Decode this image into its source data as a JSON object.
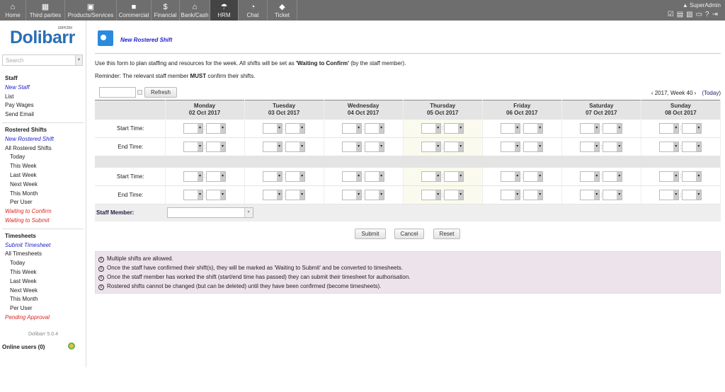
{
  "topmenu": [
    {
      "label": "Home",
      "icon": "home-icon",
      "glyph": "⌂",
      "w": 37
    },
    {
      "label": "Third parties",
      "icon": "building-icon",
      "glyph": "▦",
      "w": 55
    },
    {
      "label": "Products/Services",
      "icon": "image-icon",
      "glyph": "▣",
      "w": 73
    },
    {
      "label": "Commercial",
      "icon": "briefcase-icon",
      "glyph": "■",
      "w": 49
    },
    {
      "label": "Financial",
      "icon": "dollar-icon",
      "glyph": "$",
      "w": 40
    },
    {
      "label": "Bank/Cash",
      "icon": "bank-icon",
      "glyph": "⌂",
      "w": 43
    },
    {
      "label": "HRM",
      "icon": "umbrella-icon",
      "glyph": "☂",
      "w": 40,
      "active": true
    },
    {
      "label": "Chat",
      "icon": "chat-icon",
      "glyph": "◔",
      "w": 41
    },
    {
      "label": "Ticket",
      "icon": "ticket-icon",
      "glyph": "◆",
      "w": 42
    }
  ],
  "user": "SuperAdmin",
  "logo": "Dolibarr",
  "logo_sub": "ERP/CRM",
  "search_placeholder": "Search",
  "sidebar": [
    {
      "label": "Staff",
      "type": "h"
    },
    {
      "label": "New Staff",
      "type": "new"
    },
    {
      "label": "List",
      "type": ""
    },
    {
      "label": "Pay Wages",
      "type": ""
    },
    {
      "label": "Send Email",
      "type": ""
    },
    {
      "type": "sep"
    },
    {
      "label": "Rostered Shifts",
      "type": "h"
    },
    {
      "label": "New Rostered Shift",
      "type": "new"
    },
    {
      "label": "All Rostered Shifts",
      "type": ""
    },
    {
      "label": "Today",
      "type": "sub"
    },
    {
      "label": "This Week",
      "type": "sub"
    },
    {
      "label": "Last Week",
      "type": "sub"
    },
    {
      "label": "Next Week",
      "type": "sub"
    },
    {
      "label": "This Month",
      "type": "sub"
    },
    {
      "label": "Per User",
      "type": "sub"
    },
    {
      "label": "Waiting to Confirm",
      "type": "red"
    },
    {
      "label": "Waiting to Submit",
      "type": "red"
    },
    {
      "type": "sep"
    },
    {
      "label": "Timesheets",
      "type": "h"
    },
    {
      "label": "Submit Timesheet",
      "type": "new"
    },
    {
      "label": "All Timesheets",
      "type": ""
    },
    {
      "label": "Today",
      "type": "sub"
    },
    {
      "label": "This Week",
      "type": "sub"
    },
    {
      "label": "Last Week",
      "type": "sub"
    },
    {
      "label": "Next Week",
      "type": "sub"
    },
    {
      "label": "This Month",
      "type": "sub"
    },
    {
      "label": "Per User",
      "type": "sub"
    },
    {
      "label": "Pending Approval",
      "type": "red"
    }
  ],
  "version": "Dolibarr 5.0.4",
  "online_users": "Online users (0)",
  "page_title": "New Rostered Shift",
  "intro_pre": "Use this form to plan staffing and resources for the week. All shifts will be set as ",
  "intro_bold": "'Waiting to Confirm'",
  "intro_post": " (by the staff member).",
  "reminder_pre": "Reminder: The relevant staff member ",
  "reminder_bold": "MUST",
  "reminder_post": " confirm their shifts.",
  "refresh": "Refresh",
  "week_label": "2017, Week 40",
  "today_link": "(Today)",
  "days": [
    {
      "name": "Monday",
      "date": "02 Oct 2017"
    },
    {
      "name": "Tuesday",
      "date": "03 Oct 2017"
    },
    {
      "name": "Wednesday",
      "date": "04 Oct 2017"
    },
    {
      "name": "Thursday",
      "date": "05 Oct 2017",
      "today": true
    },
    {
      "name": "Friday",
      "date": "06 Oct 2017"
    },
    {
      "name": "Saturday",
      "date": "07 Oct 2017"
    },
    {
      "name": "Sunday",
      "date": "08 Oct 2017"
    }
  ],
  "start_time": "Start Time:",
  "end_time": "End Time:",
  "staff_member": "Staff Member:",
  "buttons": {
    "submit": "Submit",
    "cancel": "Cancel",
    "reset": "Reset"
  },
  "notes": [
    "Multiple shifts are allowed.",
    "Once the staff have confirmed their shift(s), they will be marked as 'Waiting to Submit' and be converted to timesheets.",
    "Once the staff member has worked the shift (start/end time has passed) they can submit their timesheet for authorisation.",
    "Rostered shifts cannot be changed (but can be deleted) until they have been confirmed (become timesheets)."
  ]
}
